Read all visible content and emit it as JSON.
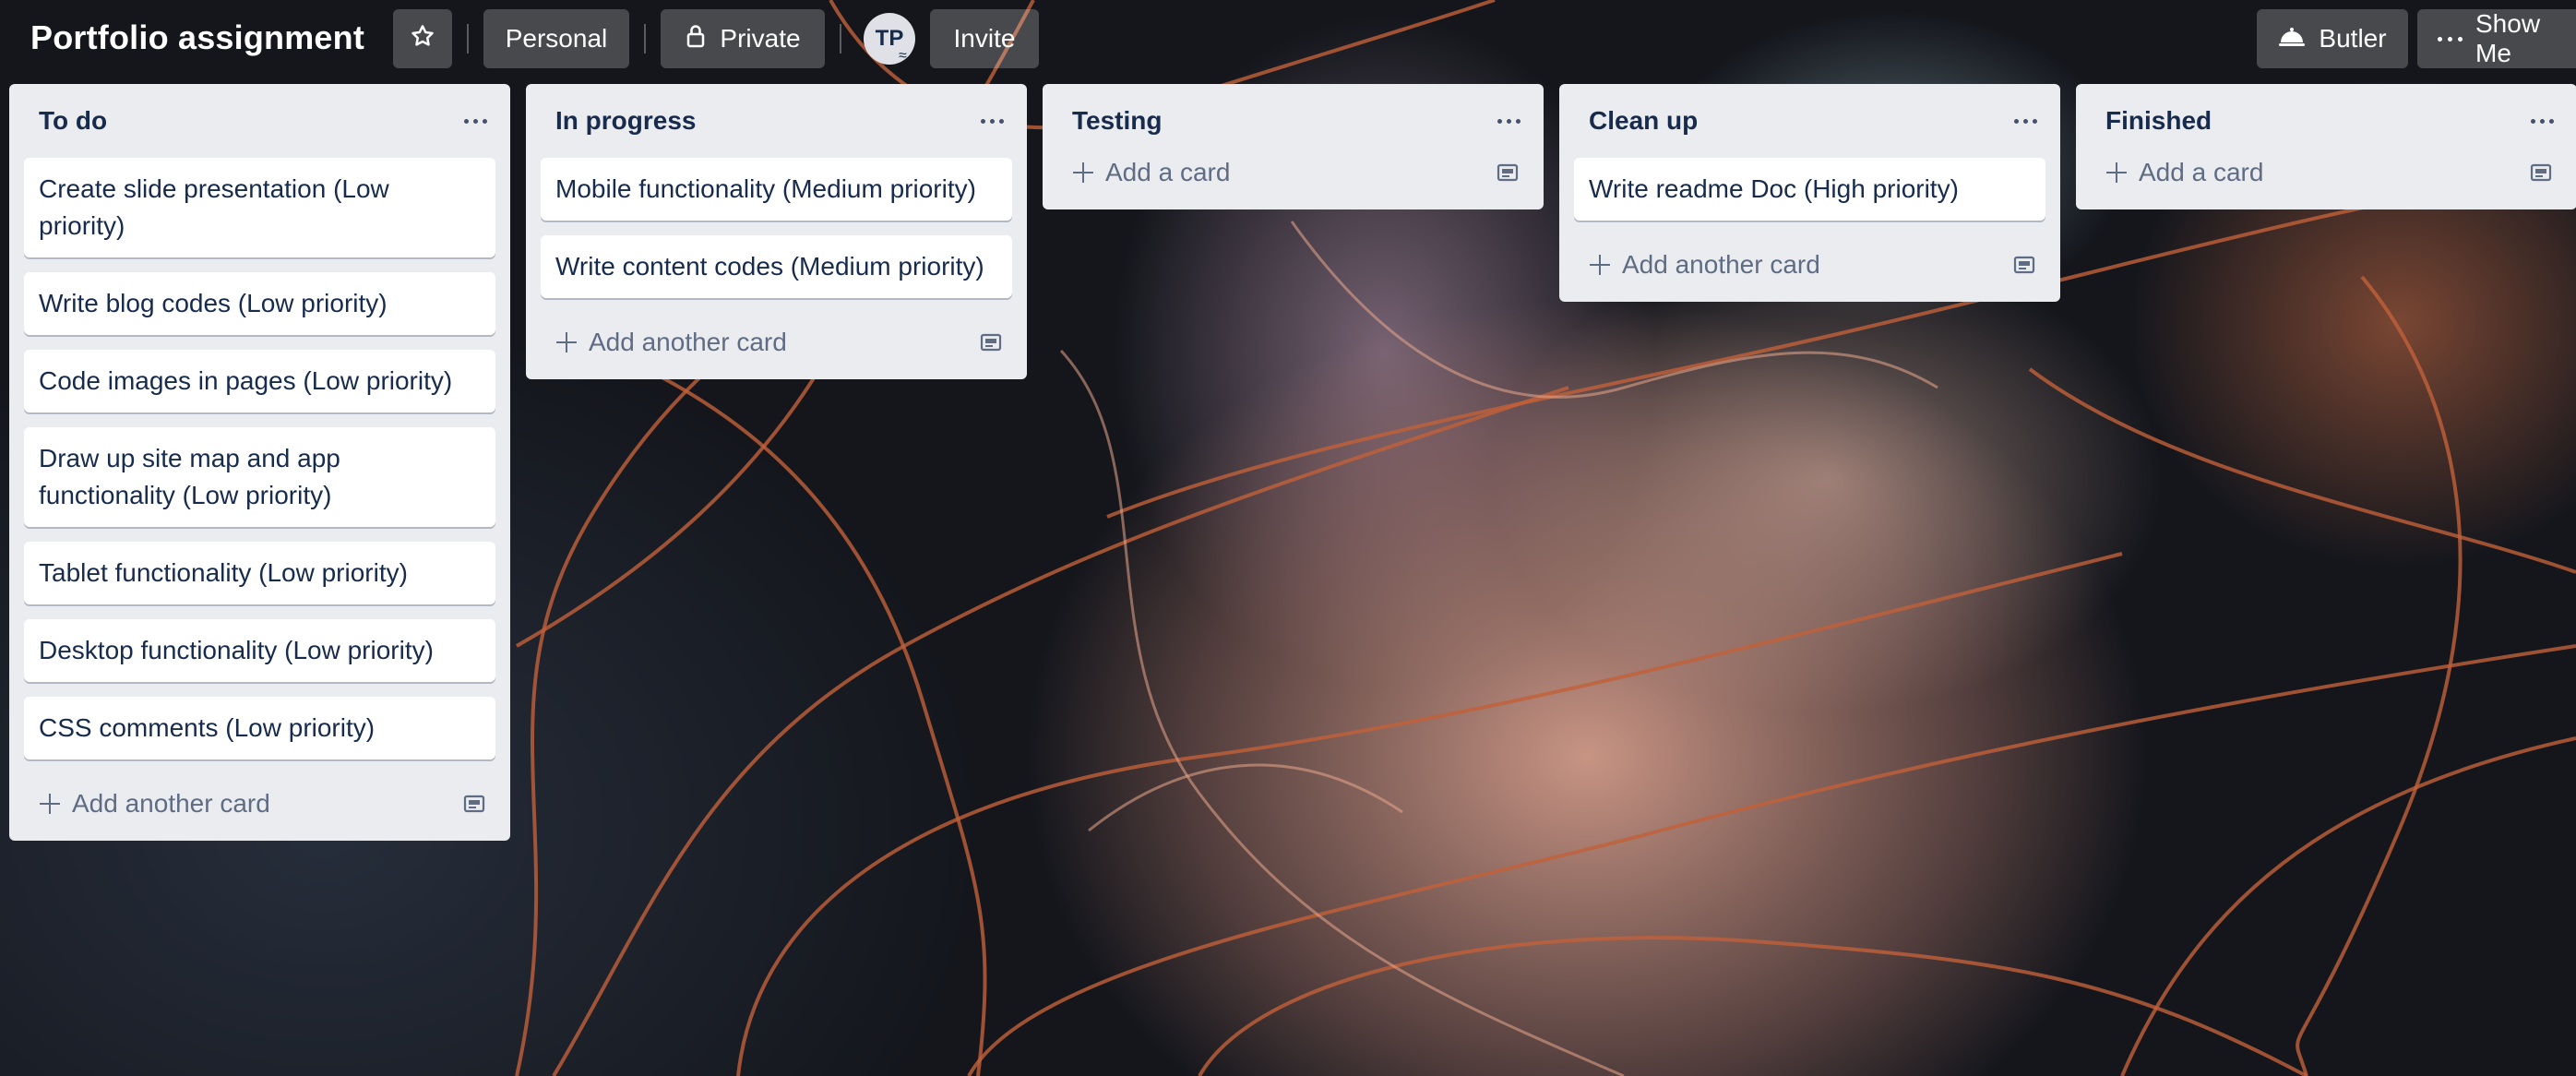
{
  "board": {
    "title": "Portfolio assignment",
    "background_image": "jellyfish-photo"
  },
  "header": {
    "star_icon": "star-icon",
    "workspace_label": "Personal",
    "visibility_label": "Private",
    "visibility_icon": "lock-icon",
    "member_initials": "TP",
    "invite_label": "Invite",
    "butler_label": "Butler",
    "butler_icon": "butler-bell-icon",
    "show_menu_label": "Show Me"
  },
  "lists": [
    {
      "title": "To do",
      "cards": [
        "Create slide presentation (Low priority)",
        "Write blog codes (Low priority)",
        "Code images in pages (Low priority)",
        "Draw up site map and app functionality (Low priority)",
        "Tablet functionality (Low priority)",
        "Desktop functionality (Low priority)",
        "CSS comments (Low priority)"
      ],
      "add_label": "Add another card"
    },
    {
      "title": "In progress",
      "cards": [
        "Mobile functionality (Medium priority)",
        "Write content codes (Medium priority)"
      ],
      "add_label": "Add another card"
    },
    {
      "title": "Testing",
      "cards": [],
      "add_label": "Add a card"
    },
    {
      "title": "Clean up",
      "cards": [
        "Write readme Doc (High priority)"
      ],
      "add_label": "Add another card"
    },
    {
      "title": "Finished",
      "cards": [],
      "add_label": "Add a card"
    }
  ],
  "colors": {
    "list_bg": "#ebecf0",
    "card_bg": "#ffffff",
    "text": "#172b4d",
    "muted": "#5e6c84"
  }
}
